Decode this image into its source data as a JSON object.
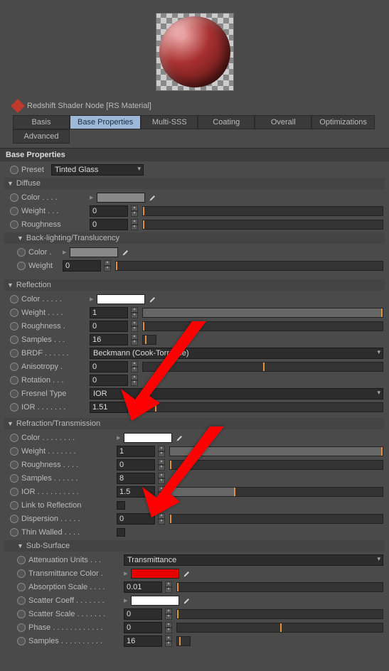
{
  "node": {
    "title": "Redshift Shader Node [RS Material]"
  },
  "tabs": [
    "Basis",
    "Base Properties",
    "Multi-SSS",
    "Coating",
    "Overall",
    "Optimizations",
    "Advanced"
  ],
  "activeTab": 1,
  "sectionTitle": "Base Properties",
  "preset": {
    "label": "Preset",
    "value": "Tinted Glass"
  },
  "groups": {
    "diffuse": {
      "title": "Diffuse",
      "color": {
        "label": "Color . . . ."
      },
      "weight": {
        "label": "Weight . . .",
        "value": "0"
      },
      "roughness": {
        "label": "Roughness",
        "value": "0"
      }
    },
    "backlighting": {
      "title": "Back-lighting/Translucency",
      "color": {
        "label": "Color ."
      },
      "weight": {
        "label": "Weight",
        "value": "0"
      }
    },
    "reflection": {
      "title": "Reflection",
      "color": {
        "label": "Color . . . . ."
      },
      "weight": {
        "label": "Weight . . . .",
        "value": "1"
      },
      "roughness": {
        "label": "Roughness .",
        "value": "0"
      },
      "samples": {
        "label": "Samples . . .",
        "value": "16"
      },
      "brdf": {
        "label": "BRDF . . . . . .",
        "value": "Beckmann (Cook-Torrance)"
      },
      "anisotropy": {
        "label": "Anisotropy .",
        "value": "0"
      },
      "rotation": {
        "label": "Rotation . . .",
        "value": "0"
      },
      "fresnelType": {
        "label": "Fresnel Type",
        "value": "IOR"
      },
      "ior": {
        "label": "IOR . . . . . . .",
        "value": "1.51"
      }
    },
    "refraction": {
      "title": "Refraction/Transmission",
      "color": {
        "label": "Color . . . . . . . ."
      },
      "weight": {
        "label": "Weight . . . . . . .",
        "value": "1"
      },
      "roughness": {
        "label": "Roughness . . . .",
        "value": "0"
      },
      "samples": {
        "label": "Samples . . . . . .",
        "value": "8"
      },
      "ior": {
        "label": "IOR . . . . . . . . . .",
        "value": "1.5"
      },
      "linkReflection": {
        "label": "Link to Reflection"
      },
      "dispersion": {
        "label": "Dispersion . . . . .",
        "value": "0"
      },
      "thinWalled": {
        "label": "Thin Walled . . . ."
      }
    },
    "subsurface": {
      "title": "Sub-Surface",
      "attenuationUnits": {
        "label": "Attenuation Units . . .",
        "value": "Transmittance"
      },
      "transmittanceColor": {
        "label": "Transmittance Color ."
      },
      "absorptionScale": {
        "label": "Absorption Scale . . . .",
        "value": "0.01"
      },
      "scatterCoeff": {
        "label": "Scatter Coeff . . . . . . ."
      },
      "scatterScale": {
        "label": "Scatter Scale . . . . . . .",
        "value": "0"
      },
      "phase": {
        "label": "Phase . . . . . . . . . . . .",
        "value": "0"
      },
      "samples": {
        "label": "Samples . . . . . . . . . .",
        "value": "16"
      }
    }
  }
}
